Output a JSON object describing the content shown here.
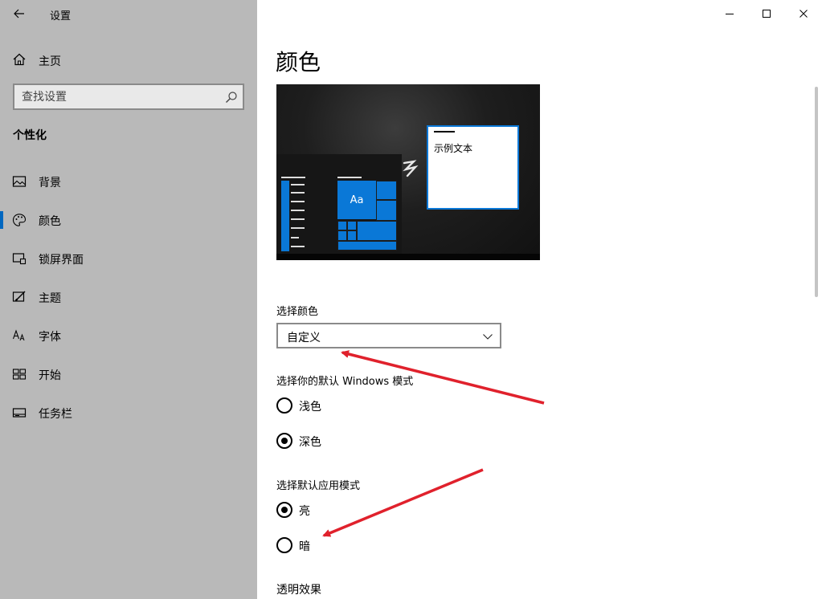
{
  "window": {
    "app_title": "设置",
    "controls": [
      "minimize-icon",
      "maximize-icon",
      "close-icon"
    ]
  },
  "sidebar": {
    "home_label": "主页",
    "search_placeholder": "查找设置",
    "section_title": "个性化",
    "items": [
      {
        "label": "背景",
        "icon": "image-icon",
        "active": false
      },
      {
        "label": "颜色",
        "icon": "palette-icon",
        "active": true
      },
      {
        "label": "锁屏界面",
        "icon": "lock-screen-icon",
        "active": false
      },
      {
        "label": "主题",
        "icon": "theme-brush-icon",
        "active": false
      },
      {
        "label": "字体",
        "icon": "font-icon",
        "active": false
      },
      {
        "label": "开始",
        "icon": "start-grid-icon",
        "active": false
      },
      {
        "label": "任务栏",
        "icon": "taskbar-icon",
        "active": false
      }
    ],
    "accent_color": "#0067c0"
  },
  "main": {
    "page_title": "颜色",
    "preview": {
      "tile_label": "Aa",
      "sample_text": "示例文本",
      "accent_color": "#0a78d7"
    },
    "choose_color": {
      "label": "选择颜色",
      "selected": "自定义"
    },
    "windows_mode": {
      "label": "选择你的默认 Windows 模式",
      "options": [
        {
          "label": "浅色",
          "checked": false
        },
        {
          "label": "深色",
          "checked": true
        }
      ]
    },
    "app_mode": {
      "label": "选择默认应用模式",
      "options": [
        {
          "label": "亮",
          "checked": true
        },
        {
          "label": "暗",
          "checked": false
        }
      ]
    },
    "transparency_label": "透明效果"
  },
  "annotation_color": "#e0212c"
}
